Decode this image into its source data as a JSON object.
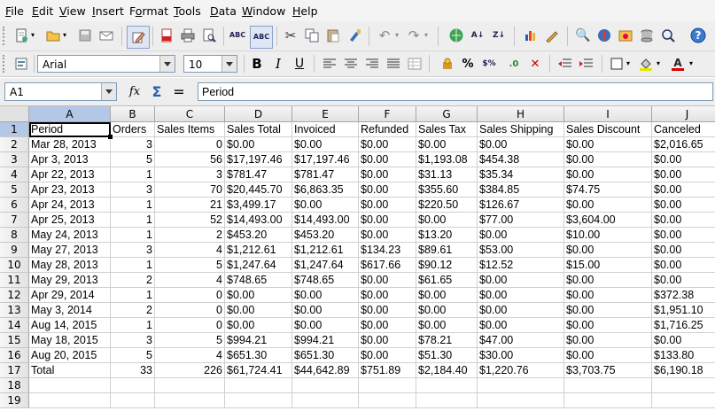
{
  "menubar": {
    "items": [
      {
        "label": "File",
        "u": "F"
      },
      {
        "label": "Edit",
        "u": "E"
      },
      {
        "label": "View",
        "u": "V"
      },
      {
        "label": "Insert",
        "u": "I"
      },
      {
        "label": "Format",
        "u": "o"
      },
      {
        "label": "Tools",
        "u": "T"
      },
      {
        "label": "Data",
        "u": "D"
      },
      {
        "label": "Window",
        "u": "W"
      },
      {
        "label": "Help",
        "u": "H"
      }
    ]
  },
  "toolbar": {
    "font_name": "Arial",
    "font_size": "10",
    "bold_glyph": "B",
    "italic_glyph": "I",
    "underline_glyph": "U",
    "percent_glyph": "%",
    "currency_glyph": "$%",
    "decimal_glyph": ".0"
  },
  "formula_bar": {
    "cell_ref": "A1",
    "function_glyph": "fx",
    "sum_glyph": "Σ",
    "equals_glyph": "=",
    "content": "Period"
  },
  "sheet": {
    "active_cell": "A1",
    "columns": [
      "A",
      "B",
      "C",
      "D",
      "E",
      "F",
      "G",
      "H",
      "I",
      "J"
    ],
    "row_numbers": [
      "1",
      "2",
      "3",
      "4",
      "5",
      "6",
      "7",
      "8",
      "9",
      "10",
      "11",
      "12",
      "13",
      "14",
      "15",
      "16",
      "17",
      "18",
      "19"
    ],
    "rows": [
      [
        "Period",
        "Orders",
        "Sales Items",
        "Sales Total",
        "Invoiced",
        "Refunded",
        "Sales Tax",
        "Sales Shipping",
        "Sales Discount",
        "Canceled"
      ],
      [
        "Mar 28, 2013",
        "3",
        "0",
        "$0.00",
        "$0.00",
        "$0.00",
        "$0.00",
        "$0.00",
        "$0.00",
        "$2,016.65"
      ],
      [
        "Apr 3, 2013",
        "5",
        "56",
        "$17,197.46",
        "$17,197.46",
        "$0.00",
        "$1,193.08",
        "$454.38",
        "$0.00",
        "$0.00"
      ],
      [
        "Apr 22, 2013",
        "1",
        "3",
        "$781.47",
        "$781.47",
        "$0.00",
        "$31.13",
        "$35.34",
        "$0.00",
        "$0.00"
      ],
      [
        "Apr 23, 2013",
        "3",
        "70",
        "$20,445.70",
        "$6,863.35",
        "$0.00",
        "$355.60",
        "$384.85",
        "$74.75",
        "$0.00"
      ],
      [
        "Apr 24, 2013",
        "1",
        "21",
        "$3,499.17",
        "$0.00",
        "$0.00",
        "$220.50",
        "$126.67",
        "$0.00",
        "$0.00"
      ],
      [
        "Apr 25, 2013",
        "1",
        "52",
        "$14,493.00",
        "$14,493.00",
        "$0.00",
        "$0.00",
        "$77.00",
        "$3,604.00",
        "$0.00"
      ],
      [
        "May 24, 2013",
        "1",
        "2",
        "$453.20",
        "$453.20",
        "$0.00",
        "$13.20",
        "$0.00",
        "$10.00",
        "$0.00"
      ],
      [
        "May 27, 2013",
        "3",
        "4",
        "$1,212.61",
        "$1,212.61",
        "$134.23",
        "$89.61",
        "$53.00",
        "$0.00",
        "$0.00"
      ],
      [
        "May 28, 2013",
        "1",
        "5",
        "$1,247.64",
        "$1,247.64",
        "$617.66",
        "$90.12",
        "$12.52",
        "$15.00",
        "$0.00"
      ],
      [
        "May 29, 2013",
        "2",
        "4",
        "$748.65",
        "$748.65",
        "$0.00",
        "$61.65",
        "$0.00",
        "$0.00",
        "$0.00"
      ],
      [
        "Apr 29, 2014",
        "1",
        "0",
        "$0.00",
        "$0.00",
        "$0.00",
        "$0.00",
        "$0.00",
        "$0.00",
        "$372.38"
      ],
      [
        "May 3, 2014",
        "2",
        "0",
        "$0.00",
        "$0.00",
        "$0.00",
        "$0.00",
        "$0.00",
        "$0.00",
        "$1,951.10"
      ],
      [
        "Aug 14, 2015",
        "1",
        "0",
        "$0.00",
        "$0.00",
        "$0.00",
        "$0.00",
        "$0.00",
        "$0.00",
        "$1,716.25"
      ],
      [
        "May 18, 2015",
        "3",
        "5",
        "$994.21",
        "$994.21",
        "$0.00",
        "$78.21",
        "$47.00",
        "$0.00",
        "$0.00"
      ],
      [
        "Aug 20, 2015",
        "5",
        "4",
        "$651.30",
        "$651.30",
        "$0.00",
        "$51.30",
        "$30.00",
        "$0.00",
        "$133.80"
      ],
      [
        "Total",
        "33",
        "226",
        "$61,724.41",
        "$44,642.89",
        "$751.89",
        "$2,184.40",
        "$1,220.76",
        "$3,703.75",
        "$6,190.18"
      ]
    ]
  }
}
